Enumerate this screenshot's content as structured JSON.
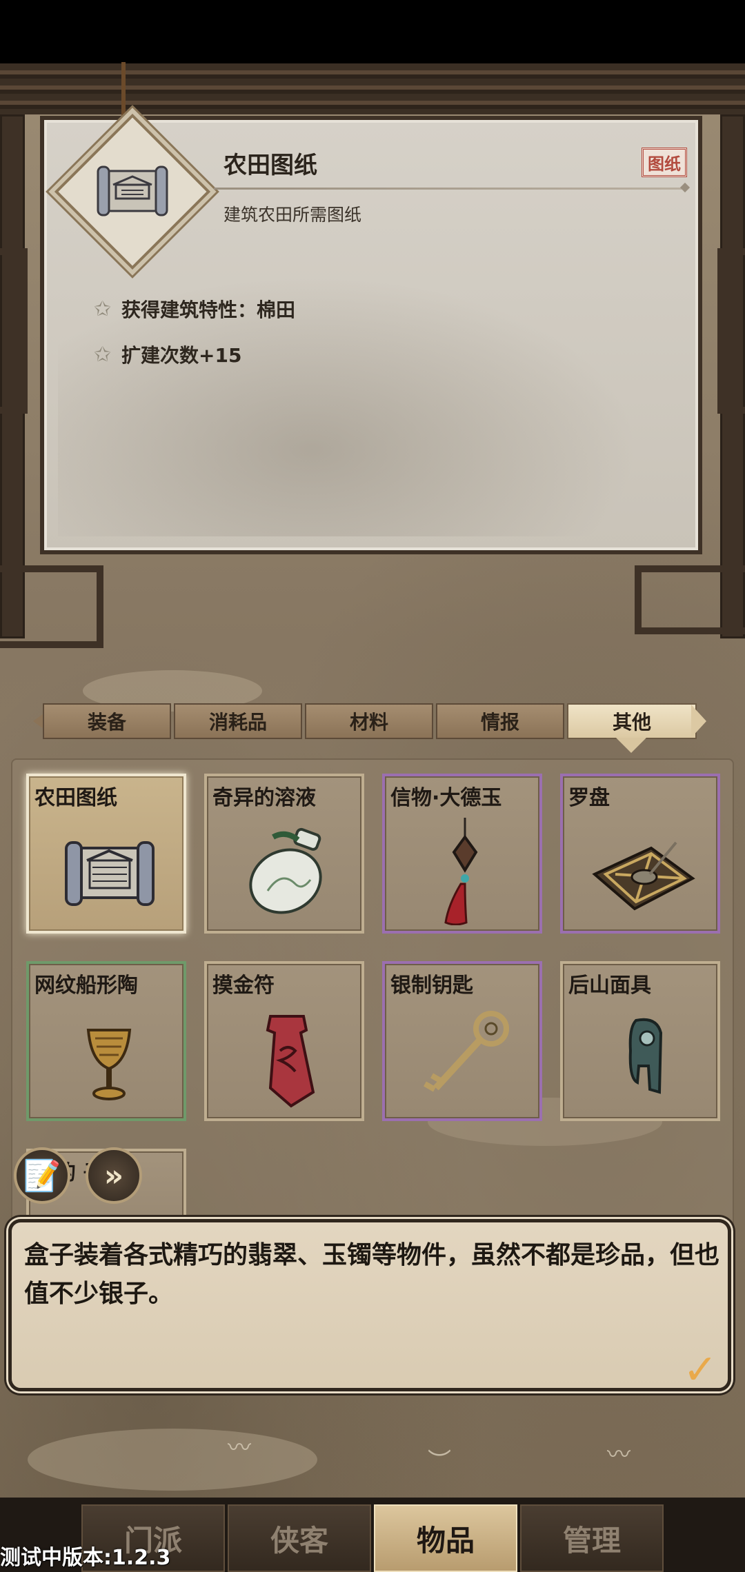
{
  "detail": {
    "title": "农田图纸",
    "tag": "图纸",
    "description": "建筑农田所需图纸",
    "traits": [
      "获得建筑特性：棉田",
      "扩建次数+15"
    ]
  },
  "tabs": [
    {
      "label": "装备",
      "active": false
    },
    {
      "label": "消耗品",
      "active": false
    },
    {
      "label": "材料",
      "active": false
    },
    {
      "label": "情报",
      "active": false
    },
    {
      "label": "其他",
      "active": true
    }
  ],
  "items": [
    {
      "name": "农田图纸",
      "icon": "blueprint-scroll-icon",
      "rarity": "selected"
    },
    {
      "name": "奇异的溶液",
      "icon": "potion-bottle-icon",
      "rarity": "common"
    },
    {
      "name": "信物·大德玉",
      "icon": "jade-pendant-icon",
      "rarity": "purple"
    },
    {
      "name": "罗盘",
      "icon": "compass-icon",
      "rarity": "purple"
    },
    {
      "name": "网纹船形陶",
      "icon": "pottery-goblet-icon",
      "rarity": "green"
    },
    {
      "name": "摸金符",
      "icon": "talisman-icon",
      "rarity": "common"
    },
    {
      "name": "银制钥匙",
      "icon": "silver-key-icon",
      "rarity": "purple"
    },
    {
      "name": "后山面具",
      "icon": "mask-icon",
      "rarity": "common"
    },
    {
      "name": "重的  子",
      "icon": "jewelry-box-icon",
      "rarity": "common"
    }
  ],
  "dialog": {
    "text": "盒子装着各式精巧的翡翠、玉镯等物件，虽然不都是珍品，但也值不少银子。"
  },
  "nav": [
    {
      "label": "门派",
      "active": false
    },
    {
      "label": "侠客",
      "active": false
    },
    {
      "label": "物品",
      "active": true
    },
    {
      "label": "管理",
      "active": false
    }
  ],
  "version": "测试中版本:1.2.3",
  "colors": {
    "accent": "#dcc69d",
    "tag_red": "#b24a3d",
    "rarity_purple": "#9b6fb0",
    "rarity_green": "#6f9a6a",
    "confirm": "#e9a94a"
  }
}
